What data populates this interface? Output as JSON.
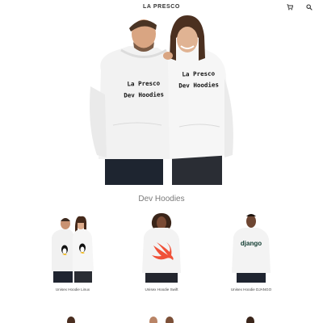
{
  "header": {
    "brand": "LA PRESCO",
    "icons": [
      "cart-icon",
      "search-icon"
    ]
  },
  "hero": {
    "left_shirt_text": [
      "La Presco",
      "Dev Hoodies"
    ],
    "right_shirt_text": [
      "La Presco",
      "Dev Hoodies"
    ]
  },
  "section": {
    "title": "Dev Hoodies"
  },
  "products": [
    {
      "name": "Unisex Hoodie Linux"
    },
    {
      "name": "Unisex Hoodie Swift"
    },
    {
      "name": "Unisex Hoodie DJANGO"
    }
  ],
  "django_logo_text": "django",
  "colors": {
    "hoodie": "#f4f4f4",
    "jeans": "#23262e",
    "swift": "#f05138"
  }
}
